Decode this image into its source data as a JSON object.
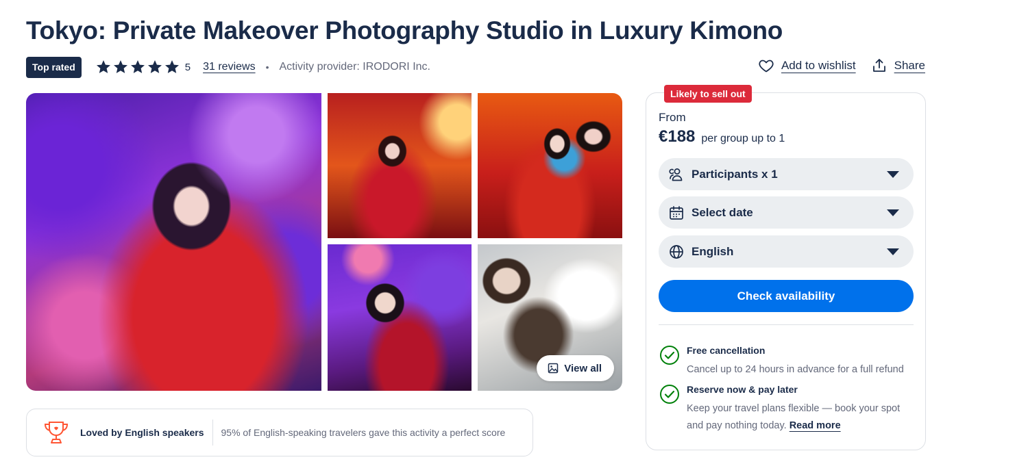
{
  "title": "Tokyo: Private Makeover Photography Studio in Luxury Kimono",
  "badge_top_rated": "Top rated",
  "rating": {
    "value": "5",
    "stars": 5,
    "reviews": "31 reviews",
    "separator": "•",
    "provider": "Activity provider: IRODORI Inc."
  },
  "actions": {
    "wishlist": "Add to wishlist",
    "share": "Share"
  },
  "gallery": {
    "view_all": "View all"
  },
  "loved": {
    "title": "Loved by English speakers",
    "text": "95% of English-speaking travelers gave this activity a perfect score"
  },
  "booking": {
    "badge": "Likely to sell out",
    "from": "From",
    "price": "€188",
    "price_note": "per group up to 1",
    "participants": "Participants x 1",
    "date": "Select date",
    "language": "English",
    "cta": "Check availability",
    "perks": [
      {
        "title": "Free cancellation",
        "desc_line1": "Cancel up to 24 hours in advance for a full refund"
      },
      {
        "title": "Reserve now & pay later",
        "desc_line1": "Keep your travel plans flexible — book your spot",
        "desc_line2": "and pay nothing today.",
        "link": "Read more"
      }
    ]
  },
  "colors": {
    "navy": "#1a2b49",
    "accent_blue": "#0071eb",
    "sell_red": "#dc2a3a",
    "check_green": "#008009",
    "trophy_orange": "#ff5533"
  }
}
